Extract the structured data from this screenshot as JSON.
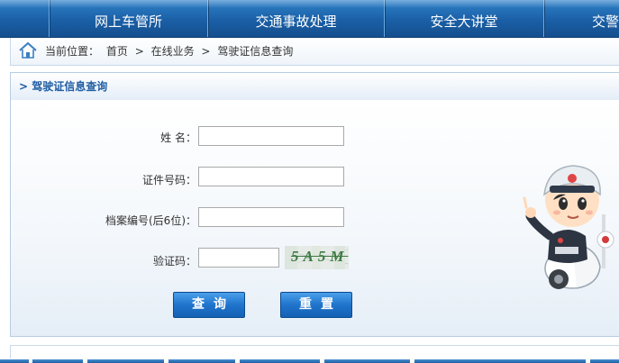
{
  "nav": {
    "items": [
      {
        "label": "网上车管所"
      },
      {
        "label": "交通事故处理"
      },
      {
        "label": "安全大讲堂"
      },
      {
        "label": "交警风"
      }
    ]
  },
  "breadcrumb": {
    "prefix": "当前位置：",
    "items": [
      "首页",
      "在线业务",
      "驾驶证信息查询"
    ],
    "separator": ">"
  },
  "section": {
    "title": "> 驾驶证信息查询"
  },
  "form": {
    "name_label": "姓 名：",
    "name_value": "",
    "id_label": "证件号码：",
    "id_value": "",
    "file_label": "档案编号(后6位)：",
    "file_value": "",
    "captcha_label": "验证码：",
    "captcha_value": "",
    "captcha_image_text": "5A5M",
    "query_button": "查询",
    "reset_button": "重置"
  },
  "colors": {
    "nav_bg": "#1a5fa6",
    "title_text": "#1f5da3",
    "button_bg": "#1f74cc"
  }
}
